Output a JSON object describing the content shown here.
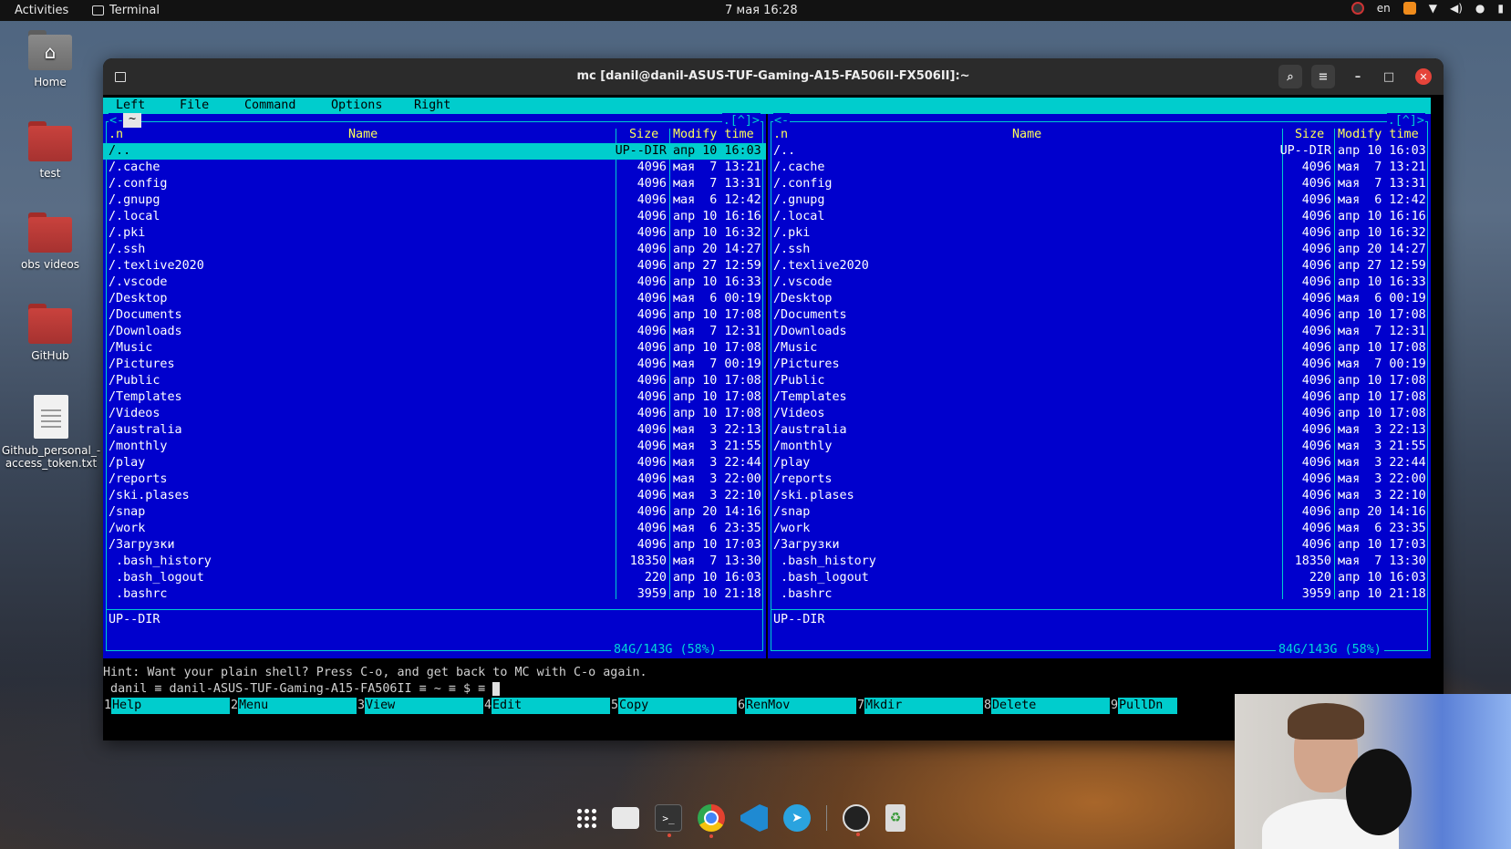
{
  "topbar": {
    "activities": "Activities",
    "app_name": "Terminal",
    "clock": "7 мая  16:28",
    "lang": "en"
  },
  "desktop_icons": [
    {
      "label": "Home",
      "icon": "home-folder-icon"
    },
    {
      "label": "test",
      "icon": "folder-icon"
    },
    {
      "label": "obs videos",
      "icon": "folder-icon"
    },
    {
      "label": "GitHub",
      "icon": "folder-icon"
    },
    {
      "label": "Github_personal_-access_token.txt",
      "icon": "text-file-icon"
    }
  ],
  "window": {
    "title": "mc [danil@danil-ASUS-TUF-Gaming-A15-FA506II-FX506II]:~"
  },
  "mc": {
    "menu": [
      "Left",
      "File",
      "Command",
      "Options",
      "Right"
    ],
    "columns": {
      "name": "Name",
      "size": "Size",
      "time": "Modify time",
      "sort": ".n"
    },
    "corner_left": "<-",
    "corner_right": ".[^]>",
    "tilde": "~",
    "files": [
      {
        "name": "/..",
        "size": "UP--DIR",
        "time": "апр 10 16:03"
      },
      {
        "name": "/.cache",
        "size": "4096",
        "time": "мая  7 13:21"
      },
      {
        "name": "/.config",
        "size": "4096",
        "time": "мая  7 13:31"
      },
      {
        "name": "/.gnupg",
        "size": "4096",
        "time": "мая  6 12:42"
      },
      {
        "name": "/.local",
        "size": "4096",
        "time": "апр 10 16:16"
      },
      {
        "name": "/.pki",
        "size": "4096",
        "time": "апр 10 16:32"
      },
      {
        "name": "/.ssh",
        "size": "4096",
        "time": "апр 20 14:27"
      },
      {
        "name": "/.texlive2020",
        "size": "4096",
        "time": "апр 27 12:59"
      },
      {
        "name": "/.vscode",
        "size": "4096",
        "time": "апр 10 16:33"
      },
      {
        "name": "/Desktop",
        "size": "4096",
        "time": "мая  6 00:19"
      },
      {
        "name": "/Documents",
        "size": "4096",
        "time": "апр 10 17:08"
      },
      {
        "name": "/Downloads",
        "size": "4096",
        "time": "мая  7 12:31"
      },
      {
        "name": "/Music",
        "size": "4096",
        "time": "апр 10 17:08"
      },
      {
        "name": "/Pictures",
        "size": "4096",
        "time": "мая  7 00:19"
      },
      {
        "name": "/Public",
        "size": "4096",
        "time": "апр 10 17:08"
      },
      {
        "name": "/Templates",
        "size": "4096",
        "time": "апр 10 17:08"
      },
      {
        "name": "/Videos",
        "size": "4096",
        "time": "апр 10 17:08"
      },
      {
        "name": "/australia",
        "size": "4096",
        "time": "мая  3 22:13"
      },
      {
        "name": "/monthly",
        "size": "4096",
        "time": "мая  3 21:55"
      },
      {
        "name": "/play",
        "size": "4096",
        "time": "мая  3 22:44"
      },
      {
        "name": "/reports",
        "size": "4096",
        "time": "мая  3 22:00"
      },
      {
        "name": "/ski.plases",
        "size": "4096",
        "time": "мая  3 22:10"
      },
      {
        "name": "/snap",
        "size": "4096",
        "time": "апр 20 14:16"
      },
      {
        "name": "/work",
        "size": "4096",
        "time": "мая  6 23:35"
      },
      {
        "name": "/Загрузки",
        "size": "4096",
        "time": "апр 10 17:03"
      },
      {
        "name": " .bash_history",
        "size": "18350",
        "time": "мая  7 13:30"
      },
      {
        "name": " .bash_logout",
        "size": "220",
        "time": "апр 10 16:03"
      },
      {
        "name": " .bashrc",
        "size": "3959",
        "time": "апр 10 21:18"
      }
    ],
    "status_left": "UP--DIR",
    "status_right": "UP--DIR",
    "free_left": "84G/143G (58%)",
    "free_right": "84G/143G (58%)",
    "hint": "Hint: Want your plain shell? Press C-o, and get back to MC with C-o again.",
    "prompt": " danil ≡ danil-ASUS-TUF-Gaming-A15-FA506II ≡ ~ ≡ $ ≡ ",
    "fkeys": [
      {
        "n": "1",
        "label": "Help"
      },
      {
        "n": "2",
        "label": "Menu"
      },
      {
        "n": "3",
        "label": "View"
      },
      {
        "n": "4",
        "label": "Edit"
      },
      {
        "n": "5",
        "label": "Copy"
      },
      {
        "n": "6",
        "label": "RenMov"
      },
      {
        "n": "7",
        "label": "Mkdir"
      },
      {
        "n": "8",
        "label": "Delete"
      },
      {
        "n": "9",
        "label": "PullDn"
      }
    ]
  },
  "dock": [
    "apps-grid-icon",
    "files-icon",
    "terminal-icon",
    "chrome-icon",
    "vscode-icon",
    "telegram-icon",
    "obs-icon",
    "trash-icon"
  ],
  "colors": {
    "mc_panel": "#0000cd",
    "mc_cyan": "#00cdcd",
    "mc_header": "#ffff55",
    "close_red": "#e5443a"
  }
}
